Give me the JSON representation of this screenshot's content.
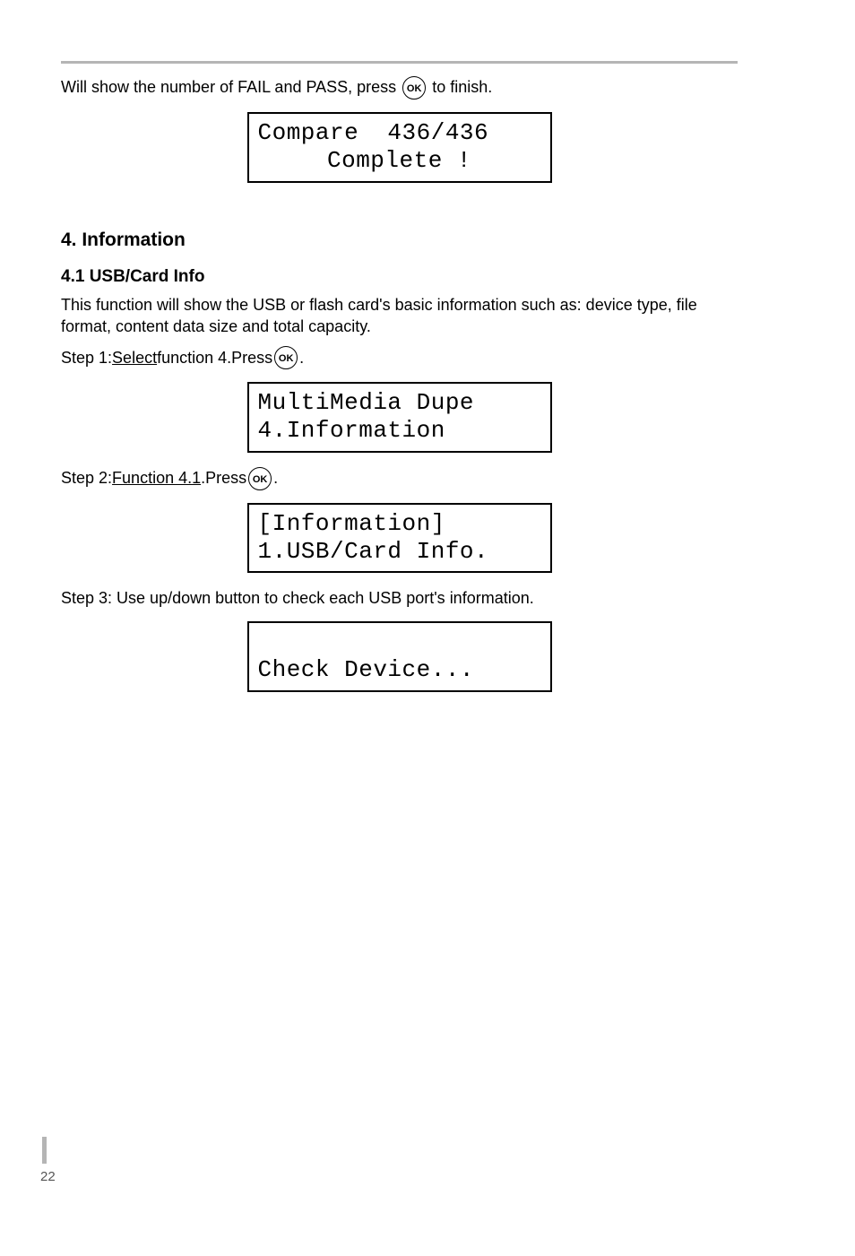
{
  "ok_label": "OK",
  "intro": {
    "line1_pre": "Will show the number of FAIL and PASS, press ",
    "line1_post": " to finish."
  },
  "lcd_compare": {
    "line1": "Compare  436/436",
    "line2": "Complete !"
  },
  "section4": {
    "heading": "4. Information",
    "sub_heading": "4.1 USB/Card Info",
    "desc": "This function will show the USB or flash card's basic information such as: device type, file format, content data size and total capacity.",
    "step1_prefix": "Step 1:",
    "step1_underline": " Select  ",
    "step1_rest": " function 4.Press ",
    "step1_post": ".",
    "step2_prefix": "Step 2:",
    "step2_underline": " Function 4.1",
    "step2_rest": " .Press ",
    "step2_post": ".",
    "step3": "Step 3: Use up/down button to check each USB port's information."
  },
  "lcd_menu": {
    "line1": "MultiMedia Dupe",
    "line2": "4.Information"
  },
  "lcd_info": {
    "line1": "[Information]",
    "line2": "1.USB/Card Info."
  },
  "lcd_check": {
    "line1": " ",
    "line2": "Check Device..."
  },
  "page_number": "22"
}
